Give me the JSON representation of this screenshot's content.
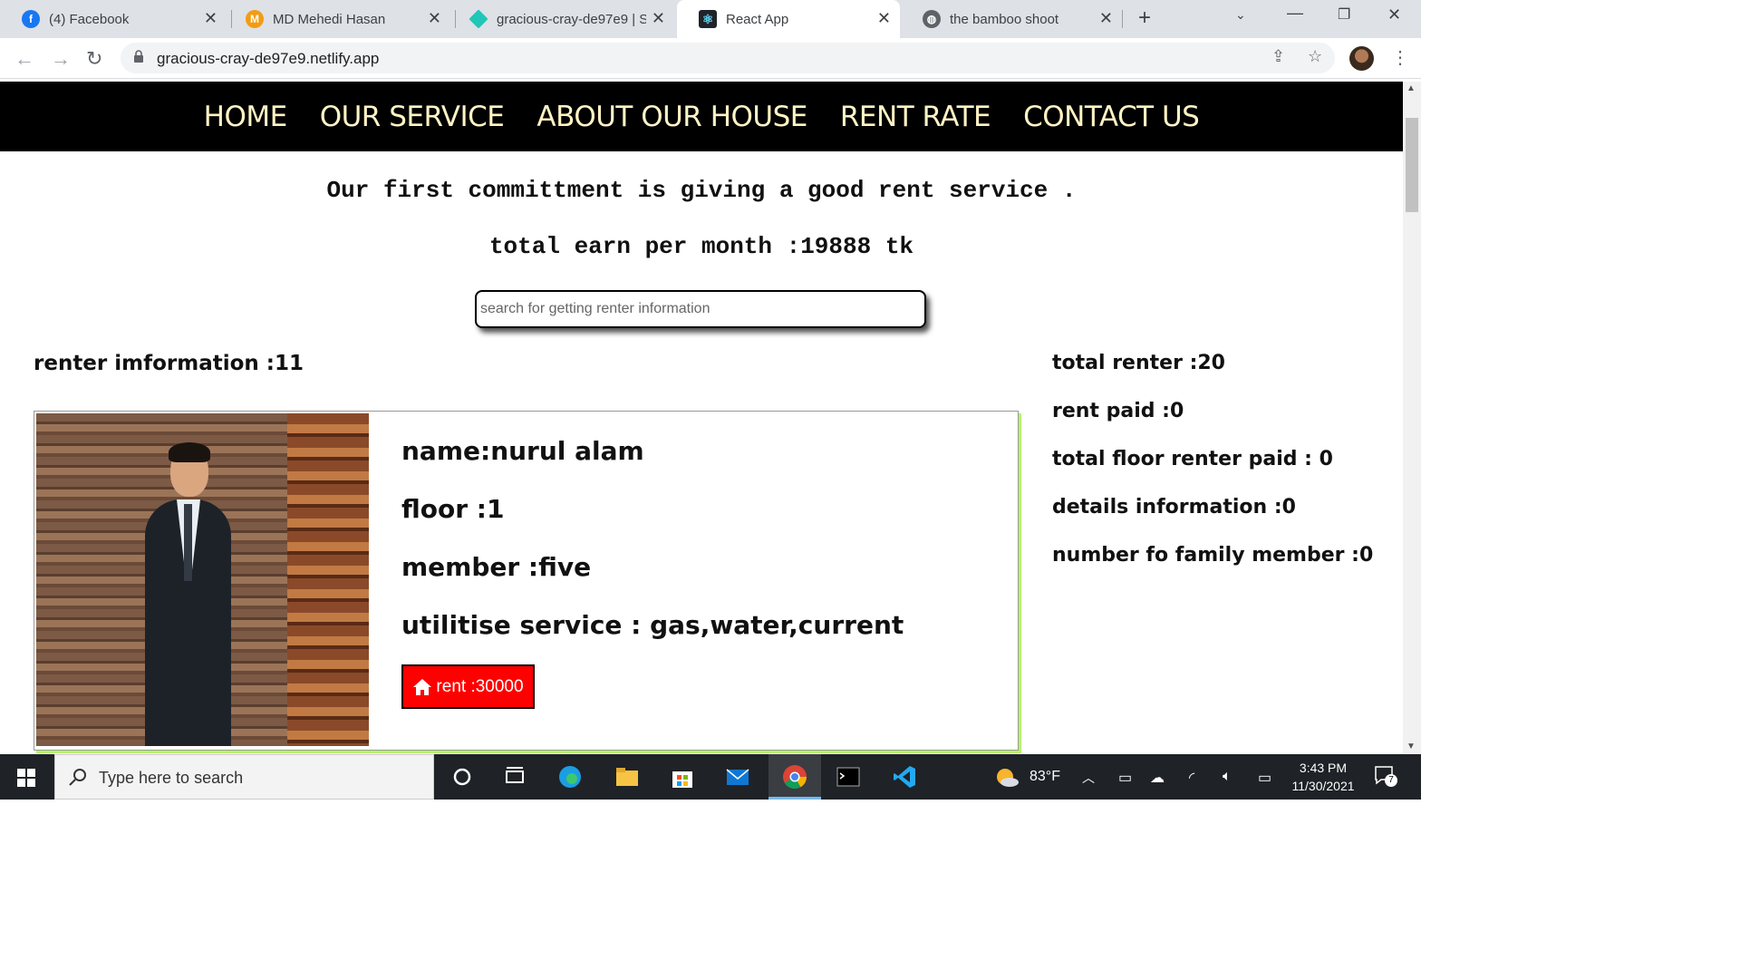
{
  "browser": {
    "tabs": [
      {
        "title": "(4) Facebook",
        "icon": "facebook-icon",
        "color": "#1877f2"
      },
      {
        "title": "MD Mehedi Hasan",
        "icon": "m-icon",
        "color": "#f39c12"
      },
      {
        "title": "gracious-cray-de97e9 | Si",
        "icon": "netlify-icon",
        "color": "#20c6b7"
      },
      {
        "title": "React App",
        "icon": "react-icon",
        "color": "#61dafb"
      },
      {
        "title": "the bamboo shoot",
        "icon": "globe-icon",
        "color": "#5f6368"
      }
    ],
    "url": "gracious-cray-de97e9.netlify.app"
  },
  "nav": {
    "items": [
      "HOME",
      "OUR SERVICE",
      "ABOUT OUR HOUSE",
      "RENT RATE",
      "CONTACT US"
    ]
  },
  "hero": {
    "line1": "Our first committment is giving a good rent service .",
    "line2": "total earn per month :19888 tk"
  },
  "search": {
    "placeholder": "search for getting renter information"
  },
  "renter_info": "renter imformation :11",
  "card": {
    "name": "name:nurul alam",
    "floor": "floor :1",
    "member": "member :five",
    "utility": "utilitise service : gas,water,current",
    "rent_label": "rent :30000"
  },
  "stats": {
    "total_renter": "total renter :20",
    "rent_paid": "rent paid :0",
    "floor_paid": "total floor renter paid : 0",
    "details": "details information :0",
    "family": "number fo family member :0"
  },
  "taskbar": {
    "search_placeholder": "Type here to search",
    "temperature": "83°F",
    "time": "3:43 PM",
    "date": "11/30/2021",
    "notifications": "7"
  },
  "colors": {
    "nav_bg": "#000000",
    "nav_text": "#fff3c4",
    "rent_button": "#ff0000",
    "card_shadow": "#b7f36b"
  }
}
